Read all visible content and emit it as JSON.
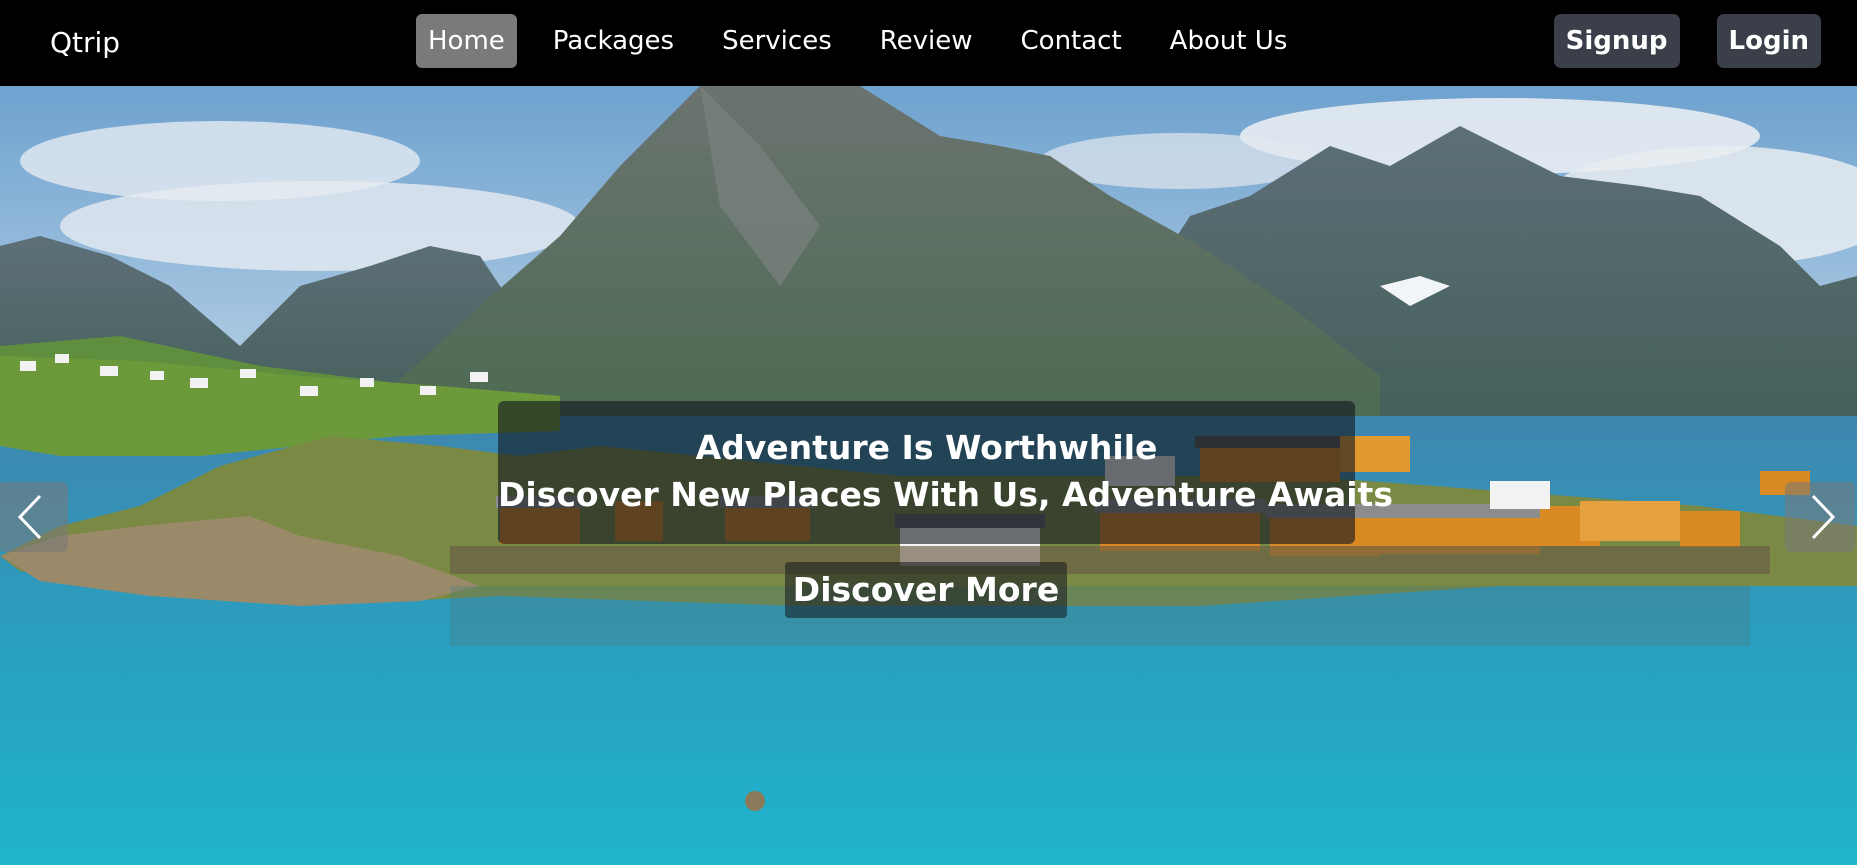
{
  "navbar": {
    "brand": "Qtrip",
    "links": [
      {
        "label": "Home",
        "active": true
      },
      {
        "label": "Packages",
        "active": false
      },
      {
        "label": "Services",
        "active": false
      },
      {
        "label": "Review",
        "active": false
      },
      {
        "label": "Contact",
        "active": false
      },
      {
        "label": "About Us",
        "active": false
      }
    ],
    "signup_label": "Signup",
    "login_label": "Login"
  },
  "hero": {
    "image": "mountain-fjord-village-photo",
    "caption_line1": "Adventure Is Worthwhile",
    "caption_line2": "Discover New Places With Us, Adventure Awaits",
    "cta_label": "Discover More",
    "prev_icon": "chevron-left-icon",
    "next_icon": "chevron-right-icon"
  },
  "colors": {
    "navbar_bg": "#000000",
    "active_link_bg": "#7a7a7a",
    "auth_button_bg": "#3a3f4a",
    "text": "#ffffff"
  }
}
